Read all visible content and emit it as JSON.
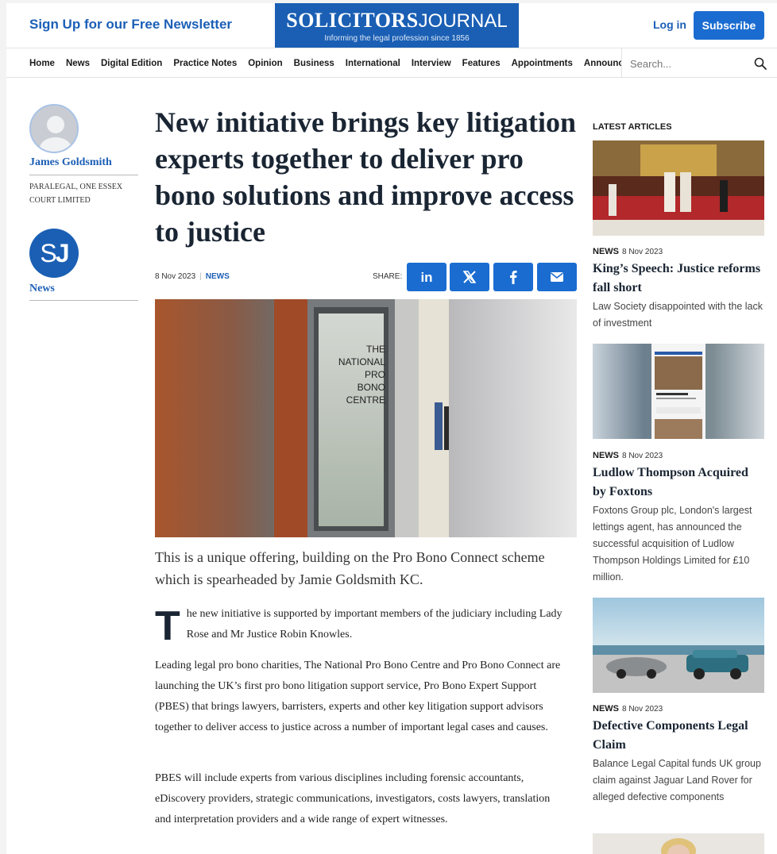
{
  "header": {
    "newsletter": "Sign Up for our Free Newsletter",
    "logo_bold": "SOLICITORS",
    "logo_light": "JOURNAL",
    "logo_tagline": "Informing the legal profession since 1856",
    "login": "Log in",
    "subscribe": "Subscribe"
  },
  "nav": {
    "items": [
      "Home",
      "News",
      "Digital Edition",
      "Practice Notes",
      "Opinion",
      "Business",
      "International",
      "Interview",
      "Features",
      "Appointments",
      "Announcements"
    ],
    "search_placeholder": "Search..."
  },
  "author": {
    "name": "James Goldsmith",
    "role": "Paralegal, ONE ESSEX COURT LIMITED",
    "badge_s": "S",
    "badge_j": "J",
    "category": "News"
  },
  "article": {
    "headline": "New initiative brings key litigation experts together to deliver pro bono solutions and improve access to justice",
    "date": "8 Nov 2023",
    "category": "NEWS",
    "share_label": "SHARE:",
    "hero_sign": [
      "THE",
      "NATIONAL",
      "PRO",
      "BONO",
      "CENTRE"
    ],
    "standfirst": "This is a unique offering, building on the Pro Bono Connect scheme which is spearheaded by Jamie Goldsmith KC.",
    "dropcap": "T",
    "para1": "he new initiative is supported by important members of the judiciary including Lady Rose and Mr Justice Robin Knowles.",
    "para2": "Leading legal pro bono charities, The National Pro Bono Centre and Pro Bono Connect are launching the UK’s first pro bono litigation support service, Pro Bono Expert Support (PBES) that brings lawyers, barristers, experts and other key litigation support advisors together to deliver access to justice across a number of important legal cases and causes.",
    "para3": "PBES will include experts from various disciplines including forensic accountants, eDiscovery providers, strategic communications, investigators, costs lawyers, translation and interpretation providers and a wide range of expert witnesses."
  },
  "sidebar": {
    "title": "LATEST ARTICLES",
    "articles": [
      {
        "cat": "NEWS",
        "date": "8 Nov 2023",
        "title": "King’s Speech: Justice reforms fall short",
        "summary": "Law Society disappointed with the lack of investment"
      },
      {
        "cat": "NEWS",
        "date": "8 Nov 2023",
        "title": "Ludlow Thompson Acquired by Foxtons",
        "summary": "Foxtons Group plc, London's largest lettings agent, has announced the successful acquisition of Ludlow Thompson Holdings Limited for £10 million."
      },
      {
        "cat": "NEWS",
        "date": "8 Nov 2023",
        "title": "Defective Components Legal Claim",
        "summary": "Balance Legal Capital funds UK group claim against Jaguar Land Rover for alleged defective components"
      }
    ]
  },
  "colors": {
    "brand": "#1a5fb4",
    "link": "#1c5fb6",
    "headline": "#1a2533"
  }
}
